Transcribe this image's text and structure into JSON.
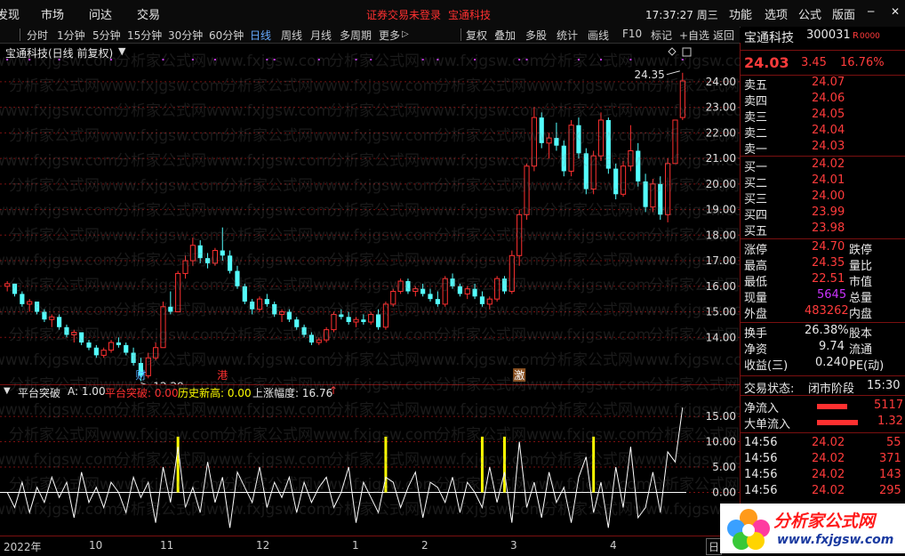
{
  "menubar": {
    "items": [
      "发现",
      "市场",
      "问达",
      "交易"
    ],
    "status": "证券交易未登录",
    "stock_name": "宝通科技",
    "clock": "17:37:27 周三",
    "right_items": [
      "功能",
      "选项",
      "公式",
      "版面"
    ]
  },
  "toolbar": {
    "periods": [
      "分时",
      "1分钟",
      "5分钟",
      "15分钟",
      "30分钟",
      "60分钟",
      "日线",
      "周线",
      "月线",
      "多周期",
      "更多"
    ],
    "selected_period": "日线",
    "tools": [
      "复权",
      "叠加",
      "多股",
      "统计",
      "画线",
      "F10",
      "标记",
      "+自选",
      "返回"
    ]
  },
  "chart_header": {
    "title": "宝通科技(日线 前复权)"
  },
  "watermark_text": "分析家公式网www.fxjgsw.com",
  "colors": {
    "up": "#ff3030",
    "down": "#54ffff",
    "bg": "#000000",
    "grid": "#7a1010",
    "signal": "#ffff00"
  },
  "chart_data": [
    {
      "type": "candlestick",
      "title": "宝通科技(日线 前复权)",
      "y_ticks": [
        "24.00",
        "23.00",
        "22.00",
        "21.00",
        "20.00",
        "19.00",
        "18.00",
        "17.00",
        "16.00",
        "15.00",
        "14.00"
      ],
      "ylim": [
        13.0,
        24.9
      ],
      "annotations": {
        "high_label": "24.35",
        "low_label": "12.29",
        "events": [
          "财",
          "港",
          "激"
        ]
      },
      "candles": [
        [
          16.0,
          16.2,
          15.8,
          16.1
        ],
        [
          16.1,
          16.1,
          15.6,
          15.7
        ],
        [
          15.7,
          15.8,
          15.2,
          15.3
        ],
        [
          15.3,
          15.5,
          15.0,
          15.4
        ],
        [
          15.4,
          15.4,
          14.9,
          15.0
        ],
        [
          15.0,
          15.1,
          14.6,
          14.7
        ],
        [
          14.7,
          14.9,
          14.4,
          14.8
        ],
        [
          14.8,
          14.9,
          14.3,
          14.4
        ],
        [
          14.4,
          14.5,
          14.0,
          14.1
        ],
        [
          14.1,
          14.3,
          13.8,
          14.2
        ],
        [
          14.2,
          14.2,
          13.7,
          13.8
        ],
        [
          13.8,
          13.9,
          13.5,
          13.6
        ],
        [
          13.6,
          13.7,
          13.2,
          13.3
        ],
        [
          13.3,
          13.6,
          13.2,
          13.5
        ],
        [
          13.5,
          13.9,
          13.4,
          13.8
        ],
        [
          13.8,
          14.0,
          13.6,
          13.7
        ],
        [
          13.7,
          13.8,
          13.3,
          13.4
        ],
        [
          13.4,
          13.6,
          12.9,
          13.0
        ],
        [
          13.0,
          13.2,
          12.29,
          12.5
        ],
        [
          12.5,
          13.4,
          12.4,
          13.2
        ],
        [
          13.2,
          13.8,
          13.1,
          13.6
        ],
        [
          13.6,
          15.4,
          13.6,
          15.2
        ],
        [
          15.2,
          15.8,
          14.9,
          15.0
        ],
        [
          15.0,
          16.6,
          15.0,
          16.5
        ],
        [
          16.5,
          17.2,
          16.3,
          17.0
        ],
        [
          17.0,
          17.9,
          16.8,
          17.6
        ],
        [
          17.6,
          17.8,
          16.9,
          17.1
        ],
        [
          17.1,
          17.3,
          16.7,
          16.9
        ],
        [
          16.9,
          17.5,
          16.8,
          17.4
        ],
        [
          17.4,
          18.3,
          17.0,
          17.2
        ],
        [
          17.2,
          17.4,
          16.5,
          16.6
        ],
        [
          16.6,
          16.8,
          15.9,
          16.0
        ],
        [
          16.0,
          16.1,
          15.3,
          15.4
        ],
        [
          15.4,
          15.5,
          14.9,
          15.1
        ],
        [
          15.1,
          15.6,
          15.0,
          15.5
        ],
        [
          15.5,
          15.7,
          15.2,
          15.3
        ],
        [
          15.3,
          15.4,
          14.8,
          14.9
        ],
        [
          14.9,
          15.1,
          14.6,
          15.0
        ],
        [
          15.0,
          15.1,
          14.6,
          14.7
        ],
        [
          14.7,
          14.8,
          14.3,
          14.4
        ],
        [
          14.4,
          14.5,
          14.0,
          14.1
        ],
        [
          14.1,
          14.2,
          13.7,
          13.8
        ],
        [
          13.8,
          14.0,
          13.7,
          13.9
        ],
        [
          13.9,
          14.4,
          13.8,
          14.3
        ],
        [
          14.3,
          15.0,
          14.2,
          14.9
        ],
        [
          14.9,
          15.1,
          14.7,
          14.8
        ],
        [
          14.8,
          15.0,
          14.5,
          14.6
        ],
        [
          14.6,
          14.8,
          14.4,
          14.7
        ],
        [
          14.7,
          14.9,
          14.5,
          14.6
        ],
        [
          14.6,
          15.0,
          14.5,
          14.9
        ],
        [
          14.9,
          15.1,
          14.3,
          14.4
        ],
        [
          14.4,
          15.4,
          14.3,
          15.3
        ],
        [
          15.3,
          15.9,
          15.2,
          15.8
        ],
        [
          15.8,
          16.3,
          15.7,
          16.2
        ],
        [
          16.2,
          16.3,
          15.7,
          15.8
        ],
        [
          15.8,
          16.0,
          15.6,
          15.9
        ],
        [
          15.9,
          16.1,
          15.6,
          15.7
        ],
        [
          15.7,
          15.9,
          15.4,
          15.5
        ],
        [
          15.5,
          15.8,
          15.2,
          15.3
        ],
        [
          15.3,
          16.4,
          15.2,
          16.3
        ],
        [
          16.3,
          16.5,
          15.9,
          16.0
        ],
        [
          16.0,
          16.1,
          15.6,
          15.7
        ],
        [
          15.7,
          16.0,
          15.5,
          15.9
        ],
        [
          15.9,
          16.1,
          15.5,
          15.6
        ],
        [
          15.6,
          15.8,
          15.2,
          15.3
        ],
        [
          15.3,
          15.6,
          15.1,
          15.5
        ],
        [
          15.5,
          16.4,
          15.4,
          16.3
        ],
        [
          16.3,
          16.4,
          15.7,
          15.8
        ],
        [
          15.8,
          17.4,
          15.7,
          17.2
        ],
        [
          17.2,
          19.0,
          16.8,
          18.8
        ],
        [
          18.8,
          20.8,
          18.6,
          20.7
        ],
        [
          20.7,
          23.0,
          20.5,
          22.6
        ],
        [
          22.6,
          22.8,
          21.4,
          21.6
        ],
        [
          21.6,
          22.0,
          21.0,
          21.8
        ],
        [
          21.8,
          22.4,
          21.3,
          21.5
        ],
        [
          21.5,
          21.7,
          20.3,
          20.5
        ],
        [
          20.5,
          22.5,
          20.3,
          22.3
        ],
        [
          22.3,
          22.6,
          21.0,
          21.2
        ],
        [
          21.2,
          21.4,
          19.6,
          19.8
        ],
        [
          19.8,
          21.3,
          19.6,
          21.1
        ],
        [
          21.1,
          22.8,
          20.9,
          22.5
        ],
        [
          22.5,
          22.6,
          20.4,
          20.6
        ],
        [
          20.6,
          20.8,
          19.4,
          19.6
        ],
        [
          19.6,
          20.9,
          19.5,
          20.7
        ],
        [
          20.7,
          22.3,
          20.5,
          21.3
        ],
        [
          21.3,
          21.6,
          19.9,
          20.1
        ],
        [
          20.1,
          20.4,
          18.9,
          19.1
        ],
        [
          19.1,
          20.2,
          18.9,
          20.0
        ],
        [
          20.0,
          20.3,
          18.6,
          18.8
        ],
        [
          18.8,
          21.0,
          18.5,
          20.8
        ],
        [
          20.8,
          22.4,
          21.5,
          22.5
        ],
        [
          22.6,
          24.35,
          22.5,
          24.03
        ]
      ]
    },
    {
      "type": "line",
      "title": "平台突破",
      "legend": [
        {
          "label": "A: 1.00",
          "color": "#e8e8e8"
        },
        {
          "label": "平台突破: 0.00",
          "color": "#ff3030"
        },
        {
          "label": "历史新高: 0.00",
          "color": "#ffff00"
        },
        {
          "label": "上涨幅度: 16.76",
          "color": "#e8e8e8"
        }
      ],
      "y_ticks": [
        "15.00",
        "10.00",
        "5.00",
        "0.00"
      ],
      "ylim": [
        -8,
        18
      ],
      "baseline": 0,
      "series": [
        {
          "name": "上涨幅度",
          "color": "#ffffff",
          "values": [
            0,
            -3,
            2,
            -4,
            1,
            -2,
            3,
            -1,
            2,
            -5,
            4,
            -2,
            1,
            -3,
            2,
            0,
            -4,
            3,
            -1,
            2,
            -6,
            5,
            -2,
            9,
            -3,
            1,
            -4,
            6,
            -2,
            3,
            -7,
            4,
            1,
            -2,
            5,
            -3,
            2,
            -1,
            3,
            -4,
            2,
            -2,
            1,
            3,
            -3,
            0,
            5,
            -6,
            2,
            -1,
            -4,
            3,
            2,
            -3,
            1,
            4,
            -5,
            2,
            1,
            -2,
            3,
            -4,
            2,
            0,
            -3,
            5,
            -2,
            4,
            -6,
            10,
            -3,
            2,
            -5,
            4,
            -2,
            1,
            -6,
            3,
            7,
            -4,
            2,
            -7,
            5,
            -3,
            9,
            -5,
            -3,
            4,
            -4,
            8,
            6,
            16.76
          ]
        }
      ],
      "signals": {
        "name": "平台突破",
        "color": "#ffff00",
        "indices": [
          23,
          51,
          64,
          67,
          79
        ],
        "value": 11
      }
    }
  ],
  "time_axis": [
    "2022年",
    "10",
    "11",
    "12",
    "1",
    "2",
    "3",
    "4",
    "日"
  ],
  "quote": {
    "name": "宝通科技",
    "code": "300031",
    "tag": "R",
    "price": "24.03",
    "change": "3.45",
    "pct": "16.76%",
    "asks": [
      {
        "label": "卖五",
        "price": "24.07"
      },
      {
        "label": "卖四",
        "price": "24.06"
      },
      {
        "label": "卖三",
        "price": "24.05"
      },
      {
        "label": "卖二",
        "price": "24.04"
      },
      {
        "label": "卖一",
        "price": "24.03"
      }
    ],
    "bids": [
      {
        "label": "买一",
        "price": "24.02"
      },
      {
        "label": "买二",
        "price": "24.01"
      },
      {
        "label": "买三",
        "price": "24.00"
      },
      {
        "label": "买四",
        "price": "23.99"
      },
      {
        "label": "买五",
        "price": "23.98"
      }
    ],
    "stats": [
      {
        "k": "涨停",
        "v": "24.70",
        "k2": "跌停"
      },
      {
        "k": "最高",
        "v": "24.35",
        "k2": "量比"
      },
      {
        "k": "最低",
        "v": "22.51",
        "k2": "市值"
      },
      {
        "k": "现量",
        "v": "5645",
        "k2": "总量"
      },
      {
        "k": "外盘",
        "v": "483262",
        "k2": "内盘"
      }
    ],
    "stats2": [
      {
        "k": "换手",
        "v": "26.38%",
        "k2": "股本"
      },
      {
        "k": "净资",
        "v": "9.74",
        "k2": "流通"
      },
      {
        "k": "收益(三)",
        "v": "0.240",
        "k2": "PE(动)"
      }
    ],
    "trade_status_label": "交易状态:",
    "trade_status": "闭市阶段",
    "trade_time": "15:30",
    "net_inflow_label": "净流入",
    "net_inflow": "5117",
    "big_inflow_label": "大单流入",
    "big_inflow": "1.32",
    "ticks": [
      {
        "t": "14:56",
        "p": "24.02",
        "v": "55"
      },
      {
        "t": "14:56",
        "p": "24.02",
        "v": "371"
      },
      {
        "t": "14:56",
        "p": "24.02",
        "v": "143"
      },
      {
        "t": "14:56",
        "p": "24.02",
        "v": "295"
      }
    ]
  },
  "logo": {
    "title": "分析家公式网",
    "url": "www.fxjgsw.com"
  }
}
